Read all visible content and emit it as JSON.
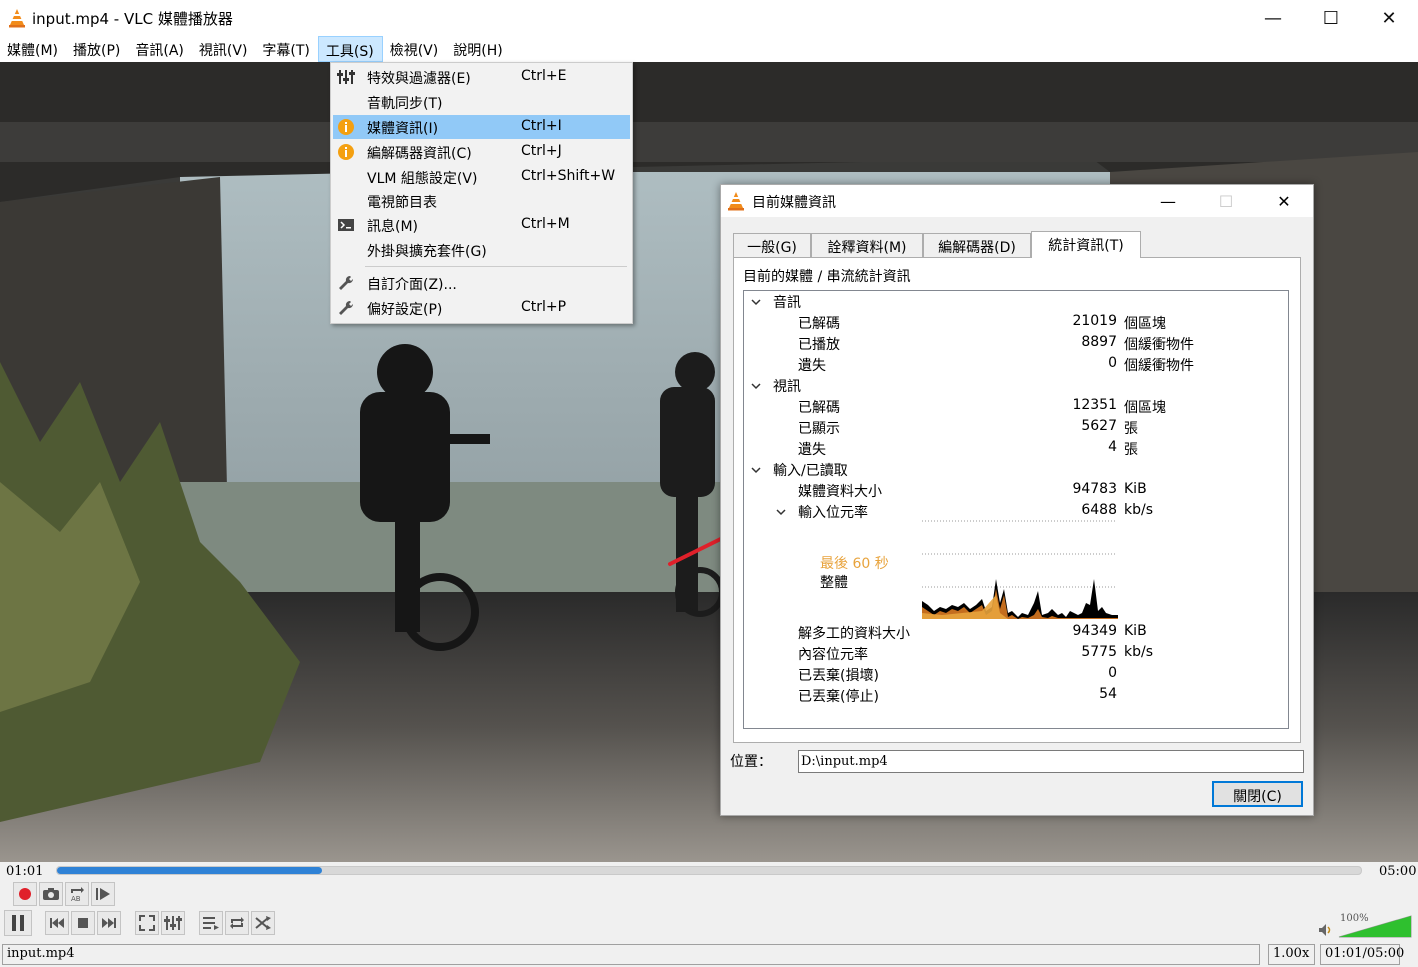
{
  "window": {
    "title": "input.mp4 - VLC 媒體播放器",
    "minimize": "—",
    "maximize": "☐",
    "close": "✕"
  },
  "menubar": {
    "items": [
      "媒體(M)",
      "播放(P)",
      "音訊(A)",
      "視訊(V)",
      "字幕(T)",
      "工具(S)",
      "檢視(V)",
      "說明(H)"
    ],
    "active_index": 5
  },
  "tools_menu": {
    "items": [
      {
        "label": "特效與過濾器(E)",
        "shortcut": "Ctrl+E",
        "icon": "sliders-icon"
      },
      {
        "label": "音軌同步(T)",
        "shortcut": "",
        "icon": ""
      },
      {
        "label": "媒體資訊(I)",
        "shortcut": "Ctrl+I",
        "icon": "info-icon",
        "highlighted": true
      },
      {
        "label": "編解碼器資訊(C)",
        "shortcut": "Ctrl+J",
        "icon": "info-icon"
      },
      {
        "label": "VLM 組態設定(V)",
        "shortcut": "Ctrl+Shift+W",
        "icon": ""
      },
      {
        "label": "電視節目表",
        "shortcut": "",
        "icon": ""
      },
      {
        "label": "訊息(M)",
        "shortcut": "Ctrl+M",
        "icon": "terminal-icon"
      },
      {
        "label": "外掛與擴充套件(G)",
        "shortcut": "",
        "icon": ""
      },
      {
        "label": "自訂介面(Z)...",
        "shortcut": "",
        "icon": "wrench-icon"
      },
      {
        "label": "偏好設定(P)",
        "shortcut": "Ctrl+P",
        "icon": "wrench-icon"
      }
    ]
  },
  "dialog": {
    "title": "目前媒體資訊",
    "minimize": "—",
    "maximize": "☐",
    "close": "✕",
    "tabs": [
      "一般(G)",
      "詮釋資料(M)",
      "編解碼器(D)",
      "統計資訊(T)"
    ],
    "active_tab": 3,
    "heading": "目前的媒體 / 串流統計資訊",
    "audio": {
      "label": "音訊",
      "rows": [
        {
          "label": "已解碼",
          "value": "21019",
          "unit": "個區塊"
        },
        {
          "label": "已播放",
          "value": "8897",
          "unit": "個緩衝物件"
        },
        {
          "label": "遺失",
          "value": "0",
          "unit": "個緩衝物件"
        }
      ]
    },
    "video": {
      "label": "視訊",
      "rows": [
        {
          "label": "已解碼",
          "value": "12351",
          "unit": "個區塊"
        },
        {
          "label": "已顯示",
          "value": "5627",
          "unit": "張"
        },
        {
          "label": "遺失",
          "value": "4",
          "unit": "張"
        }
      ]
    },
    "input": {
      "label": "輸入/已讀取",
      "media_size": {
        "label": "媒體資料大小",
        "value": "94783",
        "unit": "KiB"
      },
      "bitrate": {
        "label": "輸入位元率",
        "value": "6488",
        "unit": "kb/s"
      },
      "graph_legend_recent": "最後 60 秒",
      "graph_legend_overall": "整體",
      "rows": [
        {
          "label": "解多工的資料大小",
          "value": "94349",
          "unit": "KiB"
        },
        {
          "label": "內容位元率",
          "value": "5775",
          "unit": "kb/s"
        },
        {
          "label": "已丟棄(損壞)",
          "value": "0",
          "unit": ""
        },
        {
          "label": "已丟棄(停止)",
          "value": "54",
          "unit": ""
        }
      ]
    },
    "location_label": "位置：",
    "location_value": "D:\\input.mp4",
    "close_button": "關閉(C)"
  },
  "player": {
    "elapsed": "01:01",
    "total": "05:00",
    "progress_fraction": 0.2033,
    "volume_percent": "100%",
    "volume_fraction": 1.0,
    "status_filename": "input.mp4",
    "speed": "1.00x",
    "time_display": "01:01/05:00"
  },
  "colors": {
    "accent": "#2f82d6",
    "menu_highlight": "#91c9f7",
    "info_icon": "#f4a011",
    "annotation_arrow": "#e0202a",
    "legend_recent": "#e8a33c",
    "graph_recent": "#c46d1e",
    "record": "#e0202a",
    "volume": "#2fc02f"
  }
}
